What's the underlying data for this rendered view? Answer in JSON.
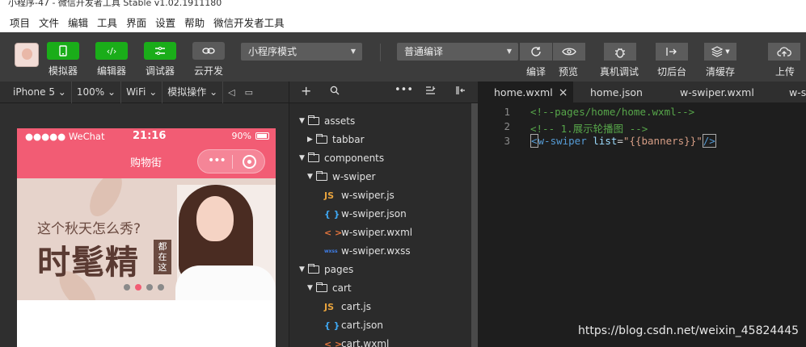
{
  "window": {
    "title": "小程序-47 - 微信开发者工具 Stable v1.02.1911180"
  },
  "menu": [
    "项目",
    "文件",
    "编辑",
    "工具",
    "界面",
    "设置",
    "帮助",
    "微信开发者工具"
  ],
  "toolbar": {
    "simulator": "模拟器",
    "editor": "编辑器",
    "debugger": "调试器",
    "cloud": "云开发",
    "mode": "小程序模式",
    "compile_mode": "普通编译",
    "compile": "编译",
    "preview": "预览",
    "remote_debug": "真机调试",
    "background": "切后台",
    "clear_cache": "清缓存",
    "upload": "上传"
  },
  "simbar": {
    "device": "iPhone 5",
    "zoom": "100%",
    "network": "WiFi",
    "ops": "模拟操作"
  },
  "phone": {
    "carrier": "●●●●● WeChat",
    "time": "21:16",
    "battery": "90%",
    "title": "购物街",
    "capsule_dots": "•••",
    "banner_line1": "这个秋天怎么秀?",
    "banner_line2": "时髦精",
    "banner_stamp": [
      "都",
      "在",
      "这"
    ],
    "indicator_count": 4,
    "indicator_active": 2
  },
  "tree": {
    "rows": [
      {
        "type": "folder",
        "open": true,
        "name": "assets",
        "level": 0
      },
      {
        "type": "folder",
        "open": false,
        "name": "tabbar",
        "level": 1
      },
      {
        "type": "folder",
        "open": true,
        "name": "components",
        "level": 0
      },
      {
        "type": "folder",
        "open": true,
        "name": "w-swiper",
        "level": 1
      },
      {
        "type": "js",
        "icon": "JS",
        "name": "w-swiper.js",
        "level": 2
      },
      {
        "type": "json",
        "icon": "{ }",
        "name": "w-swiper.json",
        "level": 2
      },
      {
        "type": "wxml",
        "icon": "< >",
        "name": "w-swiper.wxml",
        "level": 2
      },
      {
        "type": "wxss",
        "icon": "wxss",
        "name": "w-swiper.wxss",
        "level": 2
      },
      {
        "type": "folder",
        "open": true,
        "name": "pages",
        "level": 0
      },
      {
        "type": "folder",
        "open": true,
        "name": "cart",
        "level": 1
      },
      {
        "type": "js",
        "icon": "JS",
        "name": "cart.js",
        "level": 2
      },
      {
        "type": "json",
        "icon": "{ }",
        "name": "cart.json",
        "level": 2
      },
      {
        "type": "wxml",
        "icon": "< >",
        "name": "cart.wxml",
        "level": 2
      }
    ]
  },
  "tabs": [
    {
      "label": "home.wxml",
      "active": true
    },
    {
      "label": "home.json",
      "active": false
    },
    {
      "label": "w-swiper.wxml",
      "active": false
    },
    {
      "label": "w-s",
      "active": false
    }
  ],
  "editor": {
    "lines": [
      {
        "num": "1",
        "comment": "<!--pages/home/home.wxml-->"
      },
      {
        "num": "2",
        "comment": "<!-- 1.展示轮播图 -->"
      },
      {
        "num": "3",
        "tag_open": "<",
        "tag": "w-swiper",
        "attr": " list",
        "eq": "=",
        "str": "\"{{banners}}\"",
        "tag_close": "/>"
      }
    ]
  },
  "watermark": "https://blog.csdn.net/weixin_45824445",
  "colors": {
    "accent_green": "#1aad19",
    "nav_pink": "#f25c74",
    "editor_bg": "#1e1e1e"
  }
}
